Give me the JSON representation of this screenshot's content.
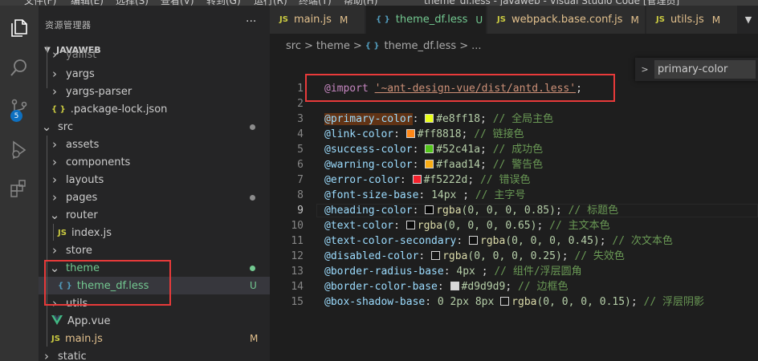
{
  "menubar": {
    "items": [
      "文件(F)",
      "编辑(E)",
      "选择(S)",
      "查看(V)",
      "转到(G)",
      "运行(R)",
      "终端(T)",
      "帮助(H)"
    ],
    "window_title": "theme_df.less - javaweb - Visual Studio Code [管理员]"
  },
  "activity_bar": {
    "icons": [
      "explorer-icon",
      "search-icon",
      "source-control-icon",
      "run-debug-icon",
      "extensions-icon"
    ],
    "scm_badge": "5"
  },
  "sidebar": {
    "title": "资源管理器",
    "more": "···",
    "section": "JAVAWEB",
    "rows": [
      {
        "label": "yallist",
        "type": "folder",
        "expanded": false,
        "depth": 1
      },
      {
        "label": "yargs",
        "type": "folder",
        "expanded": false,
        "depth": 1
      },
      {
        "label": "yargs-parser",
        "type": "folder",
        "expanded": false,
        "depth": 1
      },
      {
        "label": ".package-lock.json",
        "type": "json",
        "depth": 1,
        "icon_text": "{ }"
      },
      {
        "label": "src",
        "type": "folder",
        "expanded": true,
        "depth": 0,
        "dot": "#8c8c8c"
      },
      {
        "label": "assets",
        "type": "folder",
        "expanded": false,
        "depth": 1
      },
      {
        "label": "components",
        "type": "folder",
        "expanded": false,
        "depth": 1
      },
      {
        "label": "layouts",
        "type": "folder",
        "expanded": false,
        "depth": 1
      },
      {
        "label": "pages",
        "type": "folder",
        "expanded": false,
        "depth": 1,
        "dot": "#8c8c8c"
      },
      {
        "label": "router",
        "type": "folder",
        "expanded": true,
        "depth": 1
      },
      {
        "label": "index.js",
        "type": "js",
        "depth": 2,
        "icon_text": "JS"
      },
      {
        "label": "store",
        "type": "folder",
        "expanded": false,
        "depth": 1
      },
      {
        "label": "theme",
        "type": "folder",
        "expanded": true,
        "depth": 1,
        "dot": "#73c991",
        "color": "#73c991"
      },
      {
        "label": "theme_df.less",
        "type": "less",
        "depth": 2,
        "icon_text": "{ }",
        "badge": "U",
        "color": "#73c991",
        "selected": true
      },
      {
        "label": "utils",
        "type": "folder",
        "expanded": false,
        "depth": 1
      },
      {
        "label": "App.vue",
        "type": "vue",
        "depth": 1
      },
      {
        "label": "main.js",
        "type": "js",
        "depth": 1,
        "icon_text": "JS",
        "badge": "M",
        "color": "#e2c08d"
      },
      {
        "label": "static",
        "type": "folder",
        "expanded": false,
        "depth": 0
      }
    ]
  },
  "tabs": [
    {
      "icon_text": "JS",
      "label": "main.js",
      "mark": "M",
      "active": false
    },
    {
      "icon_text": "{ }",
      "label": "theme_df.less",
      "mark": "U",
      "active": true,
      "close": "×"
    },
    {
      "icon_text": "JS",
      "label": "webpack.base.conf.js",
      "mark": "M",
      "active": false
    },
    {
      "icon_text": "JS",
      "label": "utils.js",
      "mark": "M",
      "active": false
    }
  ],
  "breadcrumb": [
    "src",
    ">",
    "theme",
    ">",
    "{ }",
    "theme_df.less",
    ">",
    "..."
  ],
  "find_widget": {
    "toggle": ">",
    "value": "primary-color"
  },
  "editor": {
    "active_line": 9,
    "lines": [
      {
        "n": "1",
        "var": "@import",
        "import": true,
        "str": "'~ant-design-vue/dist/antd.less'"
      },
      {
        "n": "2"
      },
      {
        "n": "3",
        "var": "@primary-color",
        "highlight": true,
        "swatch": "#e8ff18",
        "value": "#e8ff18",
        "comment": "// 全局主色"
      },
      {
        "n": "4",
        "var": "@link-color",
        "swatch": "#ff8818",
        "value": "#ff8818",
        "comment": "// 链接色"
      },
      {
        "n": "5",
        "var": "@success-color",
        "swatch": "#52c41a",
        "value": "#52c41a",
        "comment": "// 成功色"
      },
      {
        "n": "6",
        "var": "@warning-color",
        "swatch": "#faad14",
        "value": "#faad14",
        "comment": "// 警告色"
      },
      {
        "n": "7",
        "var": "@error-color",
        "swatch": "#f5222d",
        "value": "#f5222d",
        "comment": "// 错误色"
      },
      {
        "n": "8",
        "var": "@font-size-base",
        "num": "14px",
        "comment": "// 主字号"
      },
      {
        "n": "9",
        "var": "@heading-color",
        "swatch": "rgba(0,0,0,0.85)",
        "fn": "rgba",
        "args": "(0, 0, 0, 0.85)",
        "comment": "// 标题色"
      },
      {
        "n": "10",
        "var": "@text-color",
        "swatch": "rgba(0,0,0,0.65)",
        "fn": "rgba",
        "args": "(0, 0, 0, 0.65)",
        "comment": "// 主文本色"
      },
      {
        "n": "11",
        "var": "@text-color-secondary",
        "swatch": "rgba(0,0,0,0.45)",
        "fn": "rgba",
        "args": "(0, 0, 0, 0.45)",
        "comment": "// 次文本色"
      },
      {
        "n": "12",
        "var": "@disabled-color",
        "swatch": "rgba(0,0,0,0.25)",
        "fn": "rgba",
        "args": "(0, 0, 0, 0.25)",
        "comment": "// 失效色"
      },
      {
        "n": "13",
        "var": "@border-radius-base",
        "num": "4px",
        "comment": "// 组件/浮层圆角"
      },
      {
        "n": "14",
        "var": "@border-color-base",
        "swatch": "#d9d9d9",
        "value": "#d9d9d9",
        "comment": "// 边框色"
      },
      {
        "n": "15",
        "var": "@box-shadow-base",
        "num": "0 2px 8px",
        "swatch": "rgba(0,0,0,0.15)",
        "fn": "rgba",
        "args": "(0, 0, 0, 0.15)",
        "comment": "// 浮层阴影"
      }
    ]
  }
}
